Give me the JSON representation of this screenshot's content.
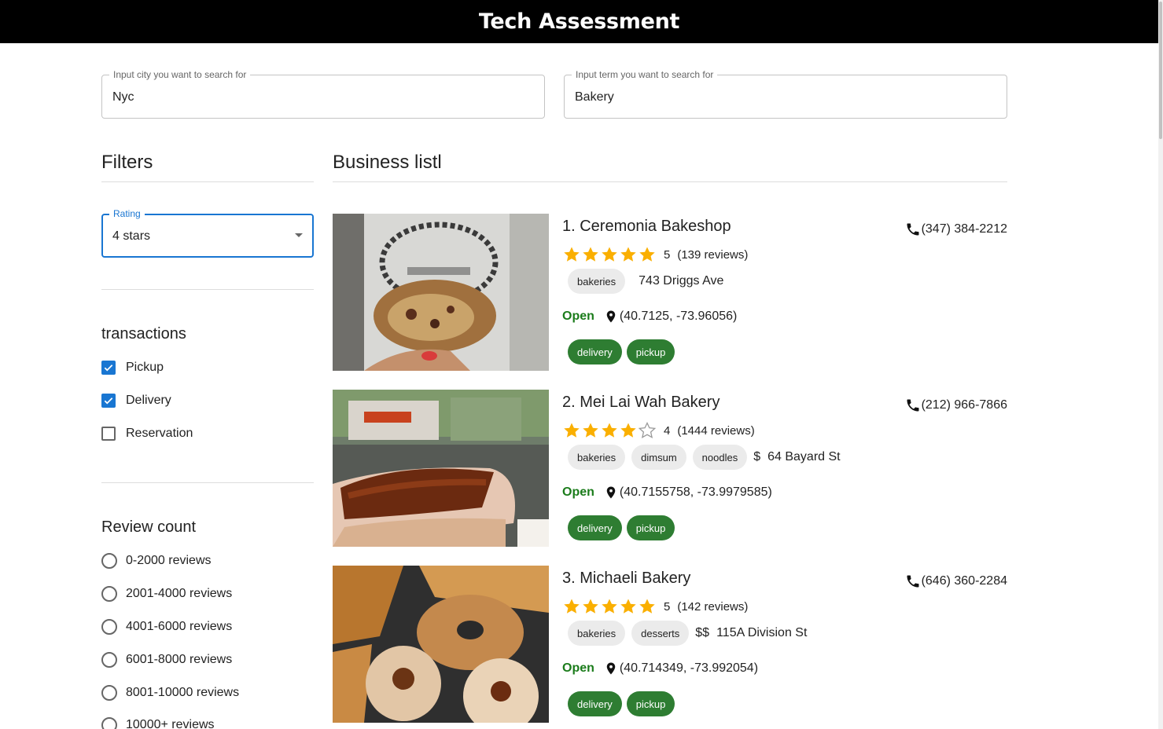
{
  "app": {
    "title": "Tech Assessment"
  },
  "search": {
    "city_label": "Input city you want to search for",
    "city_value": "Nyc",
    "term_label": "Input term you want to search for",
    "term_value": "Bakery"
  },
  "filters": {
    "title": "Filters",
    "rating": {
      "label": "Rating",
      "value": "4 stars"
    },
    "transactions": {
      "title": "transactions",
      "options": [
        {
          "label": "Pickup",
          "checked": true
        },
        {
          "label": "Delivery",
          "checked": true
        },
        {
          "label": "Reservation",
          "checked": false
        }
      ]
    },
    "review_count": {
      "title": "Review count",
      "options": [
        "0-2000 reviews",
        "2001-4000 reviews",
        "4001-6000 reviews",
        "6001-8000 reviews",
        "8001-10000 reviews",
        "10000+ reviews"
      ]
    }
  },
  "list": {
    "title": "Business listl",
    "businesses": [
      {
        "name": "1. Ceremonia Bakeshop",
        "phone": "(347) 384-2212",
        "rating": "5",
        "stars": 5,
        "reviews": "(139 reviews)",
        "categories": [
          "bakeries"
        ],
        "price": "",
        "address": "743 Driggs Ave",
        "status": "Open",
        "coords": "(40.7125, -73.96056)",
        "transactions": [
          "delivery",
          "pickup"
        ]
      },
      {
        "name": "2. Mei Lai Wah Bakery",
        "phone": "(212) 966-7866",
        "rating": "4",
        "stars": 4,
        "reviews": "(1444 reviews)",
        "categories": [
          "bakeries",
          "dimsum",
          "noodles"
        ],
        "price": "$",
        "address": "64 Bayard St",
        "status": "Open",
        "coords": "(40.7155758, -73.9979585)",
        "transactions": [
          "delivery",
          "pickup"
        ]
      },
      {
        "name": "3. Michaeli Bakery",
        "phone": "(646) 360-2284",
        "rating": "5",
        "stars": 5,
        "reviews": "(142 reviews)",
        "categories": [
          "bakeries",
          "desserts"
        ],
        "price": "$$",
        "address": "115A Division St",
        "status": "Open",
        "coords": "(40.714349, -73.992054)",
        "transactions": [
          "delivery",
          "pickup"
        ]
      }
    ]
  },
  "colors": {
    "accent": "#1976d2",
    "open": "#1b7c1b",
    "chip_green": "#2e7d32",
    "star": "#faaf00"
  }
}
